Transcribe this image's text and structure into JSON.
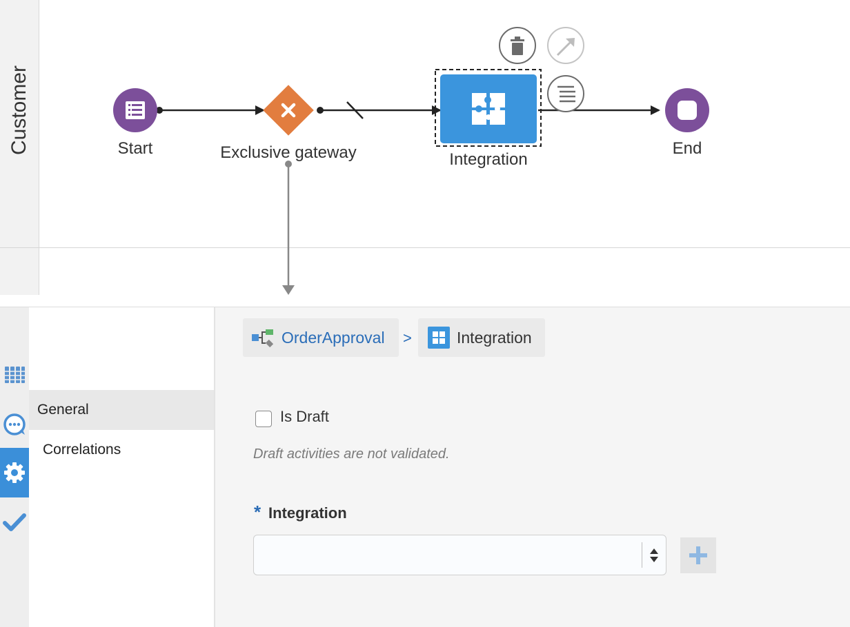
{
  "lane": {
    "name": "Customer"
  },
  "nodes": {
    "start": {
      "label": "Start"
    },
    "gateway": {
      "label": "Exclusive gateway"
    },
    "integration": {
      "label": "Integration"
    },
    "end": {
      "label": "End"
    }
  },
  "breadcrumb": {
    "process": "OrderApproval",
    "separator": ">",
    "current": "Integration"
  },
  "nav": {
    "items": [
      {
        "label": "General",
        "selected": true
      },
      {
        "label": "Correlations",
        "selected": false
      }
    ]
  },
  "form": {
    "is_draft_label": "Is Draft",
    "is_draft_checked": false,
    "draft_help": "Draft activities are not validated.",
    "required_marker": "*",
    "integration_label": "Integration",
    "integration_value": ""
  },
  "toolbar_icons": [
    "grid-icon",
    "chat-icon",
    "gear-icon",
    "check-icon"
  ],
  "colors": {
    "start_end": "#7c4f9a",
    "gateway": "#e27d3f",
    "task": "#3b95dd",
    "accent": "#3b8fd9",
    "link": "#2a6db8"
  }
}
